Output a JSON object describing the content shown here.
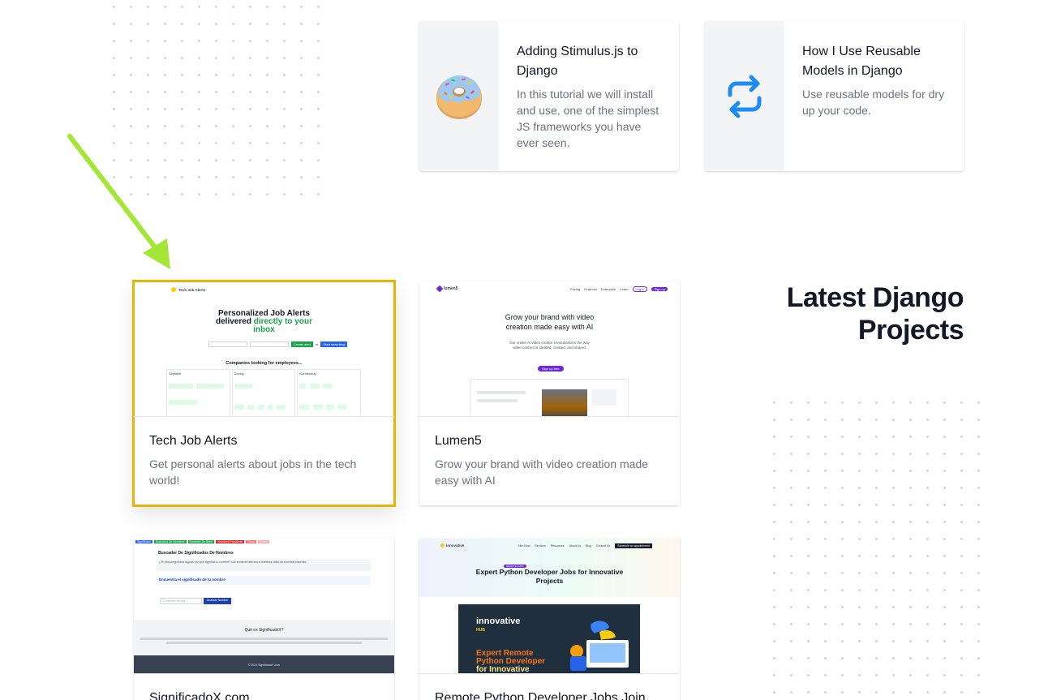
{
  "posts": [
    {
      "title": "Adding Stimulus.js to Django",
      "description": "In this tutorial we will install and use, one of the simplest JS frameworks you have ever seen.",
      "icon": "donut-icon"
    },
    {
      "title": "How I Use Reusable Models in Django",
      "description": "Use reusable models for dry up your code.",
      "icon": "refresh-arrows-icon"
    }
  ],
  "section_title": "Latest Django Projects",
  "projects": [
    {
      "title": "Tech Job Alerts",
      "description": "Get personal alerts about jobs in the tech world!",
      "thumb": {
        "brand": "Tech Job Alerts",
        "headline_1": "Personalized Job Alerts",
        "headline_2a": "delivered",
        "headline_2b": "directly to your",
        "headline_3": "inbox",
        "cta_1": "Create alert",
        "cta_sep": "or",
        "cta_2": "Start searching",
        "companies": "Companies looking for employees...",
        "col_1": "Skylable",
        "col_2": "Docely",
        "col_3": "Koridbuddy"
      }
    },
    {
      "title": "Lumen5",
      "description": "Grow your brand with video creation made easy with AI",
      "thumb": {
        "brand": "lumen5",
        "nav": [
          "Pricing",
          "Features",
          "Enterprise",
          "Learn"
        ],
        "login": "Log in",
        "signup": "Sign up",
        "headline_1": "Grow your brand with video",
        "headline_2": "creation made easy with AI",
        "sub_1": "Our online AI video creator revolutionizes the way",
        "sub_2": "video content is ideated, created, and shared.",
        "cta": "Sign up free"
      }
    },
    {
      "title": "SignificadoX.com",
      "description": "",
      "thumb": {
        "tags": [
          "Significado",
          "Buscador De Nombres",
          "Nombres De Bebé",
          "Nombres Populares",
          "Otros",
          "Temas"
        ],
        "heading": "Buscador De Significados De Nombres",
        "intro": "¿Te has preguntado alguna vez qué significa tu nombre? Los nombres afectan a nuestras vidas de muchas maneras.",
        "find_label": "Encuentra el significado de tu nombre",
        "input_placeholder": "Tu nombre de pila...",
        "button": "Analizar Nombre",
        "what_is": "Qué es SignificadoX?",
        "footer": "© 2024 SignificadoX.com"
      }
    },
    {
      "title": "Remote Python Developer Jobs Join",
      "description": "",
      "thumb": {
        "brand": "innovative",
        "nav": [
          "Hire Now",
          "Services",
          "Resources",
          "About Us",
          "Blog",
          "Contact Us"
        ],
        "cta": "Schedule an appointment",
        "badge": "REMOTE JOBS",
        "headline_1": "Expert Python Developer Jobs for Innovative",
        "headline_2": "Projects",
        "banner_brand": "innovative",
        "banner_brand_sub": "HUB",
        "banner_1": "Expert Remote",
        "banner_2": "Python Developer",
        "banner_3": "for Innovative"
      }
    }
  ],
  "colors": {
    "highlight": "#eab308",
    "arrow": "#a3e635",
    "tja_green": "#16a34a",
    "tja_blue": "#2563eb",
    "lumen_purple": "#6d28d9",
    "innovative_dark": "#1f2f3d",
    "innovative_orange": "#f97316"
  }
}
